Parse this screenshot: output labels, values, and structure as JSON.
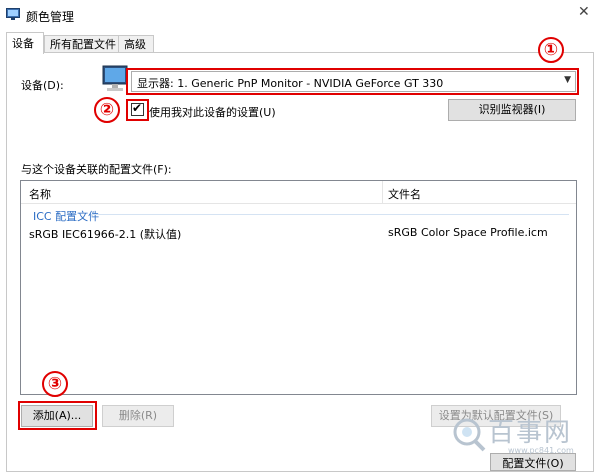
{
  "window": {
    "title": "颜色管理",
    "close_glyph": "✕"
  },
  "tabs": [
    {
      "label": "设备",
      "active": true
    },
    {
      "label": "所有配置文件",
      "active": false
    },
    {
      "label": "高级",
      "active": false
    }
  ],
  "device": {
    "label": "设备(D):",
    "selected": "显示器: 1. Generic PnP Monitor - NVIDIA GeForce GT 330",
    "use_settings_label": "使用我对此设备的设置(U)",
    "use_settings_checked": true,
    "identify_button": "识别监视器(I)"
  },
  "profiles": {
    "section_label": "与这个设备关联的配置文件(F):",
    "columns": [
      "名称",
      "文件名"
    ],
    "group": "ICC 配置文件",
    "rows": [
      {
        "name": "sRGB IEC61966-2.1 (默认值)",
        "file": "sRGB Color Space Profile.icm"
      }
    ]
  },
  "buttons": {
    "add": "添加(A)...",
    "remove": "删除(R)",
    "set_default": "设置为默认配置文件(S)",
    "profiles": "配置文件(O)"
  },
  "annotations": {
    "one": "①",
    "two": "②",
    "three": "③"
  },
  "watermark": {
    "text": "百事网",
    "url": "www.pc841.com"
  },
  "colors": {
    "annotation_red": "#e00000",
    "group_blue": "#2b6cc4"
  }
}
